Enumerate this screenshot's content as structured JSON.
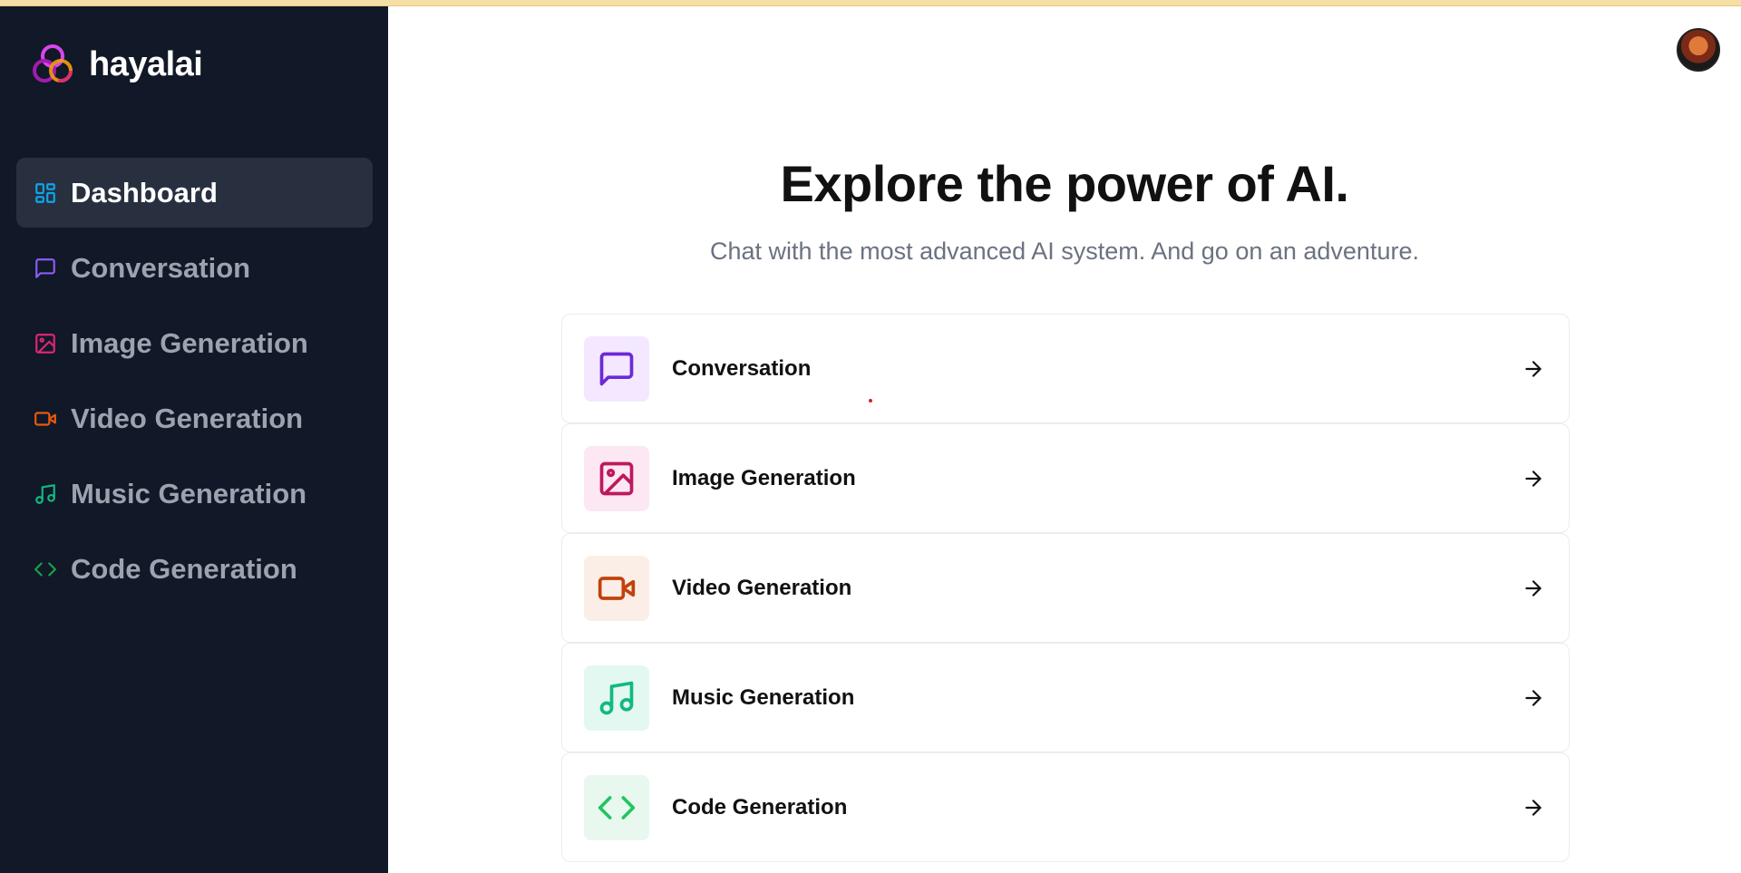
{
  "brand": {
    "name": "hayalai",
    "logo_icon": "triple-rings-logo-icon"
  },
  "sidebar": {
    "items": [
      {
        "label": "Dashboard",
        "icon": "dashboard-grid-icon",
        "color": "#0ea5e9",
        "active": true
      },
      {
        "label": "Conversation",
        "icon": "message-square-icon",
        "color": "#8b5cf6",
        "active": false
      },
      {
        "label": "Image Generation",
        "icon": "image-icon",
        "color": "#db2777",
        "active": false
      },
      {
        "label": "Video Generation",
        "icon": "video-camera-icon",
        "color": "#ea580c",
        "active": false
      },
      {
        "label": "Music Generation",
        "icon": "music-note-icon",
        "color": "#10b981",
        "active": false
      },
      {
        "label": "Code Generation",
        "icon": "code-brackets-icon",
        "color": "#16a34a",
        "active": false
      }
    ]
  },
  "header": {
    "avatar_icon": "user-avatar"
  },
  "hero": {
    "title": "Explore the power of AI.",
    "subtitle": "Chat with the most advanced AI system. And go on an adventure."
  },
  "cards": [
    {
      "label": "Conversation",
      "icon": "message-square-icon",
      "color": "#6d28d9",
      "bg": "#f3e8ff"
    },
    {
      "label": "Image Generation",
      "icon": "image-icon",
      "color": "#be185d",
      "bg": "#fce7f3"
    },
    {
      "label": "Video Generation",
      "icon": "video-camera-icon",
      "color": "#c2410c",
      "bg": "#fbeee6"
    },
    {
      "label": "Music Generation",
      "icon": "music-note-icon",
      "color": "#10b981",
      "bg": "#e3f8f0"
    },
    {
      "label": "Code Generation",
      "icon": "code-brackets-icon",
      "color": "#22c55e",
      "bg": "#e8f8ee"
    }
  ]
}
